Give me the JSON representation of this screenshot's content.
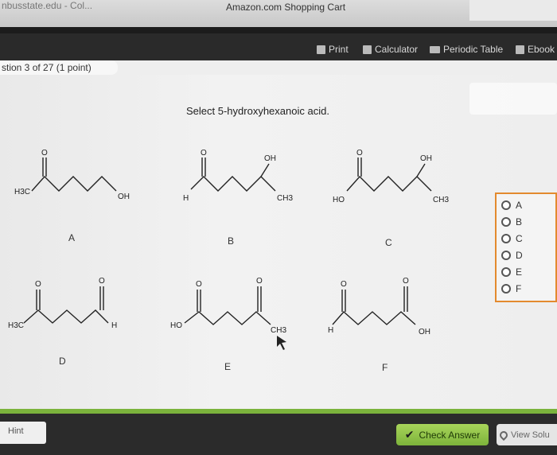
{
  "browser": {
    "left_tab": "nbusstate.edu - Col...",
    "title": "Amazon.com Shopping Cart"
  },
  "toolbar": {
    "print": "Print",
    "calculator": "Calculator",
    "periodic_table": "Periodic Table",
    "ebook": "Ebook"
  },
  "question": {
    "number": "stion 3 of 27 (1 point)",
    "prompt": "Select 5-hydroxyhexanoic acid."
  },
  "molecules": {
    "A": {
      "label": "A",
      "left": "H3C",
      "right": "OH",
      "top": "O"
    },
    "B": {
      "label": "B",
      "left": "H",
      "right": "CH3",
      "top": "O",
      "oh": "OH"
    },
    "C": {
      "label": "C",
      "left": "HO",
      "right": "CH3",
      "top": "O",
      "oh": "OH"
    },
    "D": {
      "label": "D",
      "left": "H3C",
      "right": "H",
      "top1": "O",
      "top2": "O"
    },
    "E": {
      "label": "E",
      "left": "HO",
      "right": "CH3",
      "top1": "O",
      "top2": "O"
    },
    "F": {
      "label": "F",
      "left": "H",
      "right": "OH",
      "top1": "O",
      "top2": "O"
    }
  },
  "options": [
    "A",
    "B",
    "C",
    "D",
    "E",
    "F"
  ],
  "footer": {
    "hint": "Hint",
    "check_answer": "Check Answer",
    "view_solution": "View Solu"
  },
  "colors": {
    "accent_green": "#7bb33c",
    "options_border": "#e38a2e",
    "toolbar_bg": "#2a2a2a"
  }
}
